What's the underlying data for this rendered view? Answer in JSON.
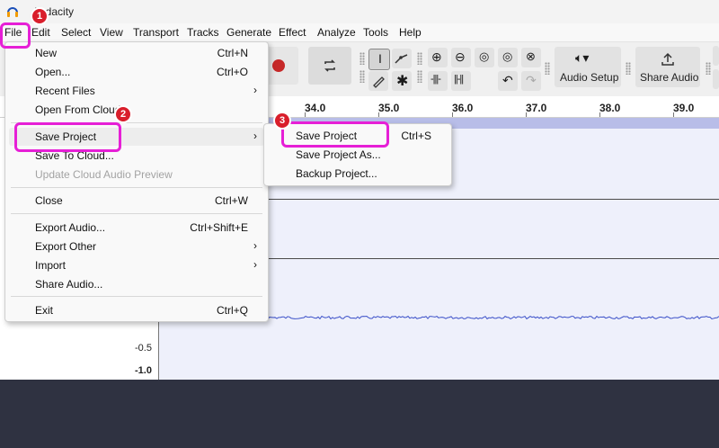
{
  "app": {
    "title": "Audacity"
  },
  "menubar": {
    "items": [
      "File",
      "Edit",
      "Select",
      "View",
      "Transport",
      "Tracks",
      "Generate",
      "Effect",
      "Analyze",
      "Tools",
      "Help"
    ]
  },
  "toolbar": {
    "audio_setup_label": "Audio Setup",
    "share_audio_label": "Share Audio"
  },
  "ruler": {
    "ticks": [
      "34.0",
      "35.0",
      "36.0",
      "37.0",
      "38.0",
      "39.0"
    ]
  },
  "track": {
    "scale_labels": [
      "-0.5",
      "-1.0"
    ]
  },
  "file_menu": {
    "items": [
      {
        "label": "New",
        "shortcut": "Ctrl+N"
      },
      {
        "label": "Open...",
        "shortcut": "Ctrl+O"
      },
      {
        "label": "Recent Files"
      },
      {
        "label": "Open From Cloud"
      },
      {
        "label": "Save Project"
      },
      {
        "label": "Save To Cloud..."
      },
      {
        "label": "Update Cloud Audio Preview"
      },
      {
        "label": "Close",
        "shortcut": "Ctrl+W"
      },
      {
        "label": "Export Audio...",
        "shortcut": "Ctrl+Shift+E"
      },
      {
        "label": "Export Other"
      },
      {
        "label": "Import"
      },
      {
        "label": "Share Audio..."
      },
      {
        "label": "Exit",
        "shortcut": "Ctrl+Q"
      }
    ]
  },
  "save_submenu": {
    "items": [
      {
        "label": "Save Project",
        "shortcut": "Ctrl+S"
      },
      {
        "label": "Save Project As..."
      },
      {
        "label": "Backup Project..."
      }
    ]
  },
  "annotations": {
    "steps": [
      "1",
      "2",
      "3"
    ],
    "color": "#e61fd6",
    "badge_color": "#d91e2b"
  }
}
